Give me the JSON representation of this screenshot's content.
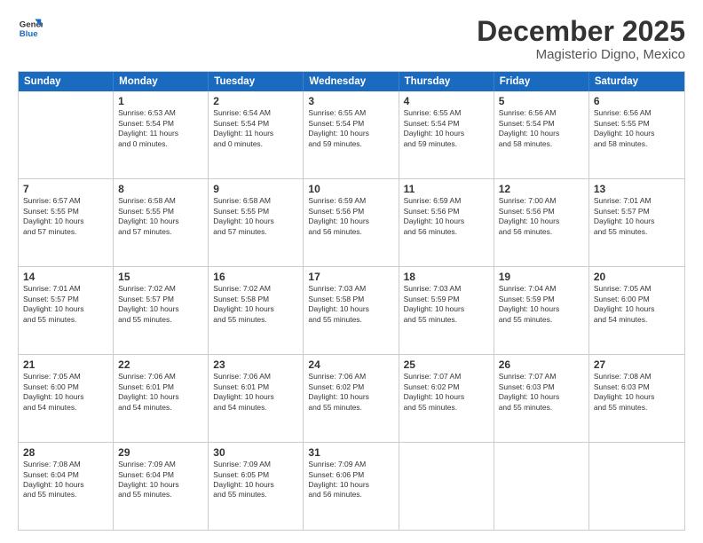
{
  "logo": {
    "line1": "General",
    "line2": "Blue"
  },
  "title": "December 2025",
  "subtitle": "Magisterio Digno, Mexico",
  "header_days": [
    "Sunday",
    "Monday",
    "Tuesday",
    "Wednesday",
    "Thursday",
    "Friday",
    "Saturday"
  ],
  "weeks": [
    [
      {
        "day": "",
        "info": ""
      },
      {
        "day": "1",
        "info": "Sunrise: 6:53 AM\nSunset: 5:54 PM\nDaylight: 11 hours\nand 0 minutes."
      },
      {
        "day": "2",
        "info": "Sunrise: 6:54 AM\nSunset: 5:54 PM\nDaylight: 11 hours\nand 0 minutes."
      },
      {
        "day": "3",
        "info": "Sunrise: 6:55 AM\nSunset: 5:54 PM\nDaylight: 10 hours\nand 59 minutes."
      },
      {
        "day": "4",
        "info": "Sunrise: 6:55 AM\nSunset: 5:54 PM\nDaylight: 10 hours\nand 59 minutes."
      },
      {
        "day": "5",
        "info": "Sunrise: 6:56 AM\nSunset: 5:54 PM\nDaylight: 10 hours\nand 58 minutes."
      },
      {
        "day": "6",
        "info": "Sunrise: 6:56 AM\nSunset: 5:55 PM\nDaylight: 10 hours\nand 58 minutes."
      }
    ],
    [
      {
        "day": "7",
        "info": "Sunrise: 6:57 AM\nSunset: 5:55 PM\nDaylight: 10 hours\nand 57 minutes."
      },
      {
        "day": "8",
        "info": "Sunrise: 6:58 AM\nSunset: 5:55 PM\nDaylight: 10 hours\nand 57 minutes."
      },
      {
        "day": "9",
        "info": "Sunrise: 6:58 AM\nSunset: 5:55 PM\nDaylight: 10 hours\nand 57 minutes."
      },
      {
        "day": "10",
        "info": "Sunrise: 6:59 AM\nSunset: 5:56 PM\nDaylight: 10 hours\nand 56 minutes."
      },
      {
        "day": "11",
        "info": "Sunrise: 6:59 AM\nSunset: 5:56 PM\nDaylight: 10 hours\nand 56 minutes."
      },
      {
        "day": "12",
        "info": "Sunrise: 7:00 AM\nSunset: 5:56 PM\nDaylight: 10 hours\nand 56 minutes."
      },
      {
        "day": "13",
        "info": "Sunrise: 7:01 AM\nSunset: 5:57 PM\nDaylight: 10 hours\nand 55 minutes."
      }
    ],
    [
      {
        "day": "14",
        "info": "Sunrise: 7:01 AM\nSunset: 5:57 PM\nDaylight: 10 hours\nand 55 minutes."
      },
      {
        "day": "15",
        "info": "Sunrise: 7:02 AM\nSunset: 5:57 PM\nDaylight: 10 hours\nand 55 minutes."
      },
      {
        "day": "16",
        "info": "Sunrise: 7:02 AM\nSunset: 5:58 PM\nDaylight: 10 hours\nand 55 minutes."
      },
      {
        "day": "17",
        "info": "Sunrise: 7:03 AM\nSunset: 5:58 PM\nDaylight: 10 hours\nand 55 minutes."
      },
      {
        "day": "18",
        "info": "Sunrise: 7:03 AM\nSunset: 5:59 PM\nDaylight: 10 hours\nand 55 minutes."
      },
      {
        "day": "19",
        "info": "Sunrise: 7:04 AM\nSunset: 5:59 PM\nDaylight: 10 hours\nand 55 minutes."
      },
      {
        "day": "20",
        "info": "Sunrise: 7:05 AM\nSunset: 6:00 PM\nDaylight: 10 hours\nand 54 minutes."
      }
    ],
    [
      {
        "day": "21",
        "info": "Sunrise: 7:05 AM\nSunset: 6:00 PM\nDaylight: 10 hours\nand 54 minutes."
      },
      {
        "day": "22",
        "info": "Sunrise: 7:06 AM\nSunset: 6:01 PM\nDaylight: 10 hours\nand 54 minutes."
      },
      {
        "day": "23",
        "info": "Sunrise: 7:06 AM\nSunset: 6:01 PM\nDaylight: 10 hours\nand 54 minutes."
      },
      {
        "day": "24",
        "info": "Sunrise: 7:06 AM\nSunset: 6:02 PM\nDaylight: 10 hours\nand 55 minutes."
      },
      {
        "day": "25",
        "info": "Sunrise: 7:07 AM\nSunset: 6:02 PM\nDaylight: 10 hours\nand 55 minutes."
      },
      {
        "day": "26",
        "info": "Sunrise: 7:07 AM\nSunset: 6:03 PM\nDaylight: 10 hours\nand 55 minutes."
      },
      {
        "day": "27",
        "info": "Sunrise: 7:08 AM\nSunset: 6:03 PM\nDaylight: 10 hours\nand 55 minutes."
      }
    ],
    [
      {
        "day": "28",
        "info": "Sunrise: 7:08 AM\nSunset: 6:04 PM\nDaylight: 10 hours\nand 55 minutes."
      },
      {
        "day": "29",
        "info": "Sunrise: 7:09 AM\nSunset: 6:04 PM\nDaylight: 10 hours\nand 55 minutes."
      },
      {
        "day": "30",
        "info": "Sunrise: 7:09 AM\nSunset: 6:05 PM\nDaylight: 10 hours\nand 55 minutes."
      },
      {
        "day": "31",
        "info": "Sunrise: 7:09 AM\nSunset: 6:06 PM\nDaylight: 10 hours\nand 56 minutes."
      },
      {
        "day": "",
        "info": ""
      },
      {
        "day": "",
        "info": ""
      },
      {
        "day": "",
        "info": ""
      }
    ]
  ]
}
